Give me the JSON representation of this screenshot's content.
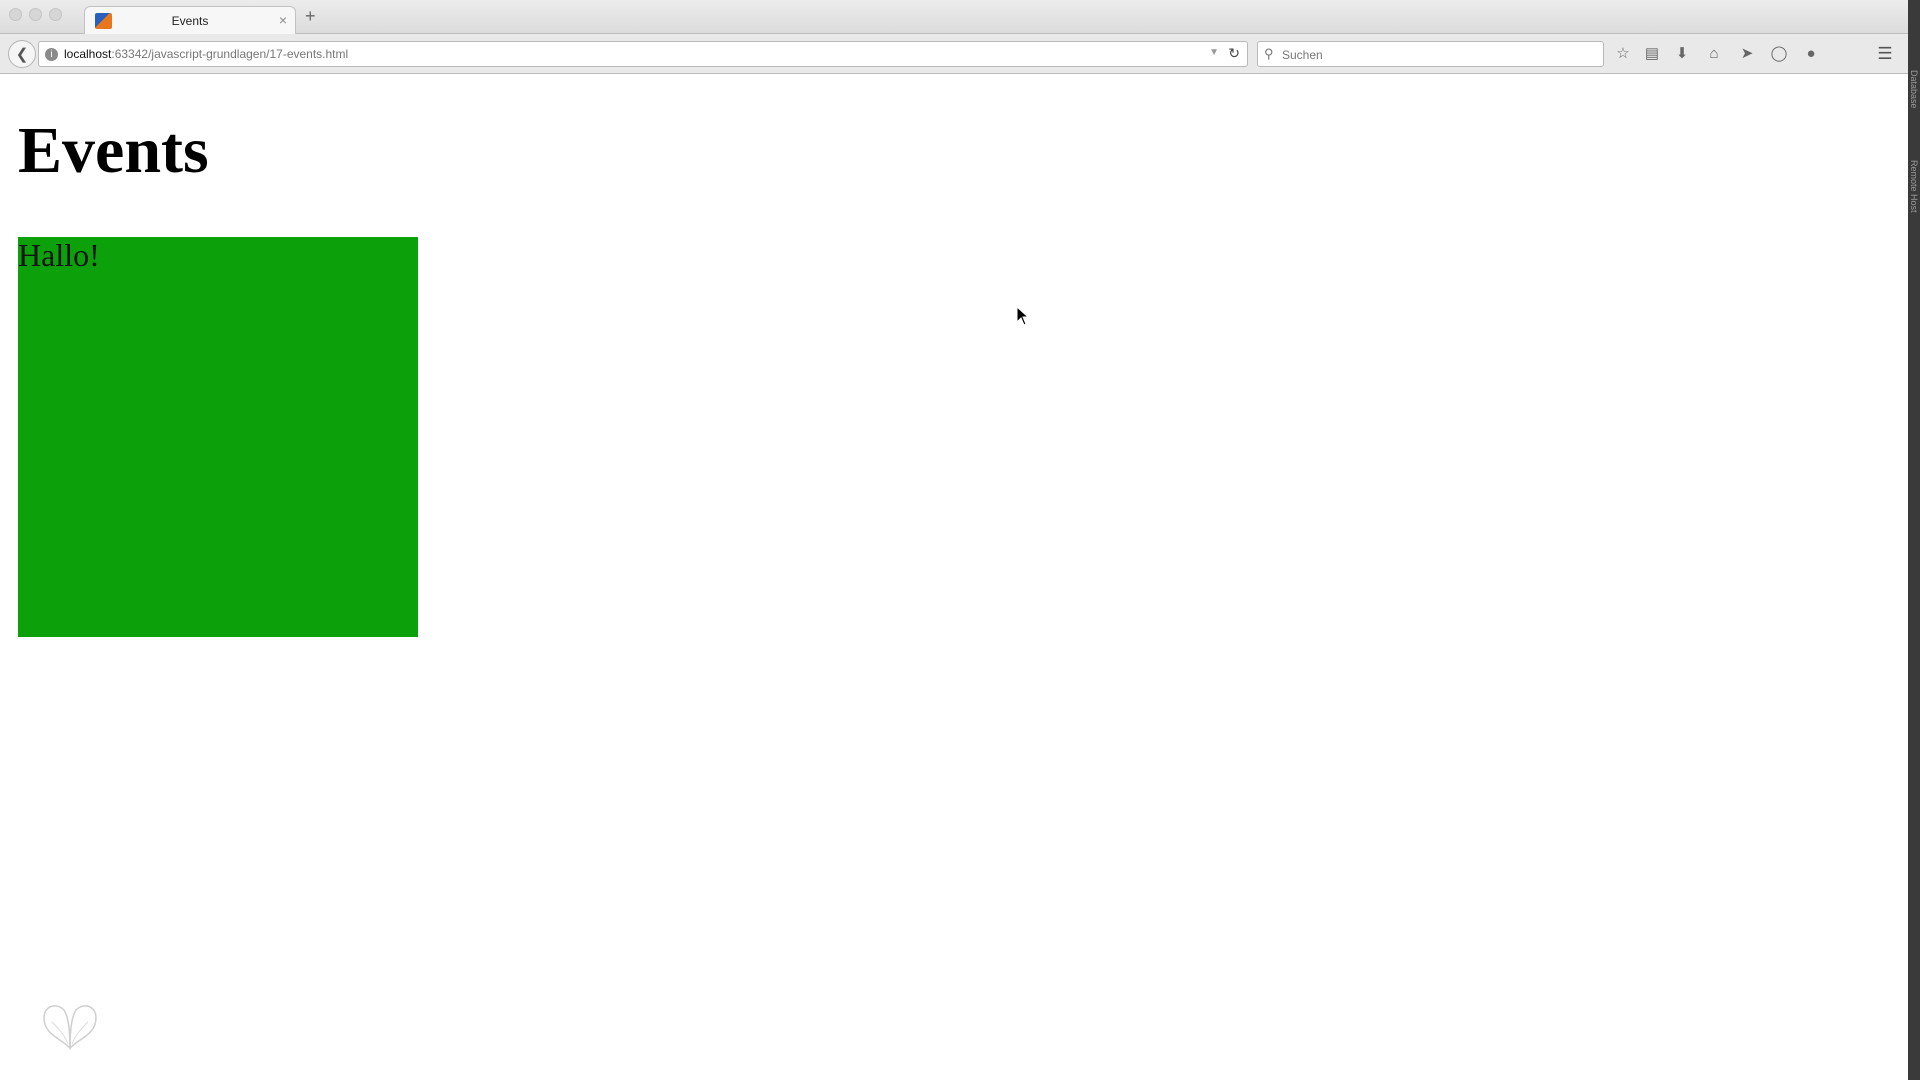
{
  "browser": {
    "tab": {
      "title": "Events",
      "close": "×"
    },
    "new_tab": "+",
    "url": {
      "host": "localhost",
      "rest": ":63342/javascript-grundlagen/17-events.html"
    },
    "search": {
      "placeholder": "Suchen"
    },
    "sidebar": {
      "label_top": "Database",
      "label_bottom": "Remote Host"
    },
    "icons": [
      "back-arrow-icon",
      "info-icon",
      "reload-icon",
      "search-icon",
      "bookmark-star-icon",
      "reading-list-icon",
      "download-icon",
      "home-icon",
      "send-icon",
      "pocket-icon",
      "chat-icon",
      "menu-icon"
    ]
  },
  "page": {
    "heading": "Events",
    "box": {
      "text": "Hallo!",
      "color": "#0ca10a"
    }
  }
}
